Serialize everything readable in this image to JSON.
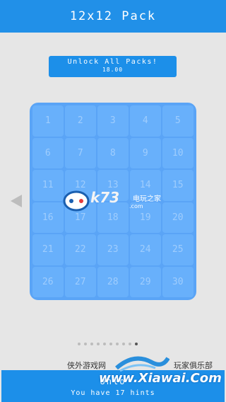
{
  "header": {
    "title": "12x12 Pack"
  },
  "unlock_all": {
    "label": "Unlock All Packs!",
    "price": "18.00"
  },
  "levels": [
    "1",
    "2",
    "3",
    "4",
    "5",
    "6",
    "7",
    "8",
    "9",
    "10",
    "11",
    "12",
    "13",
    "14",
    "15",
    "16",
    "17",
    "18",
    "19",
    "20",
    "21",
    "22",
    "23",
    "24",
    "25",
    "26",
    "27",
    "28",
    "29",
    "30"
  ],
  "pager": {
    "count": 10,
    "active_index": 9
  },
  "footer": {
    "line1": "Unlo",
    "line2": "You have 17 hints"
  },
  "watermark": {
    "k73_text": "k73",
    "k73_cn": "电玩之家",
    "k73_com": ".com",
    "left_cn": "侠外游戏网",
    "right_cn": "玩家俱乐部",
    "big": "www.Xiawai.Com"
  },
  "colors": {
    "accent": "#2190e8",
    "grid_bg": "#5aa4f6",
    "cell": "#68b0fb"
  }
}
